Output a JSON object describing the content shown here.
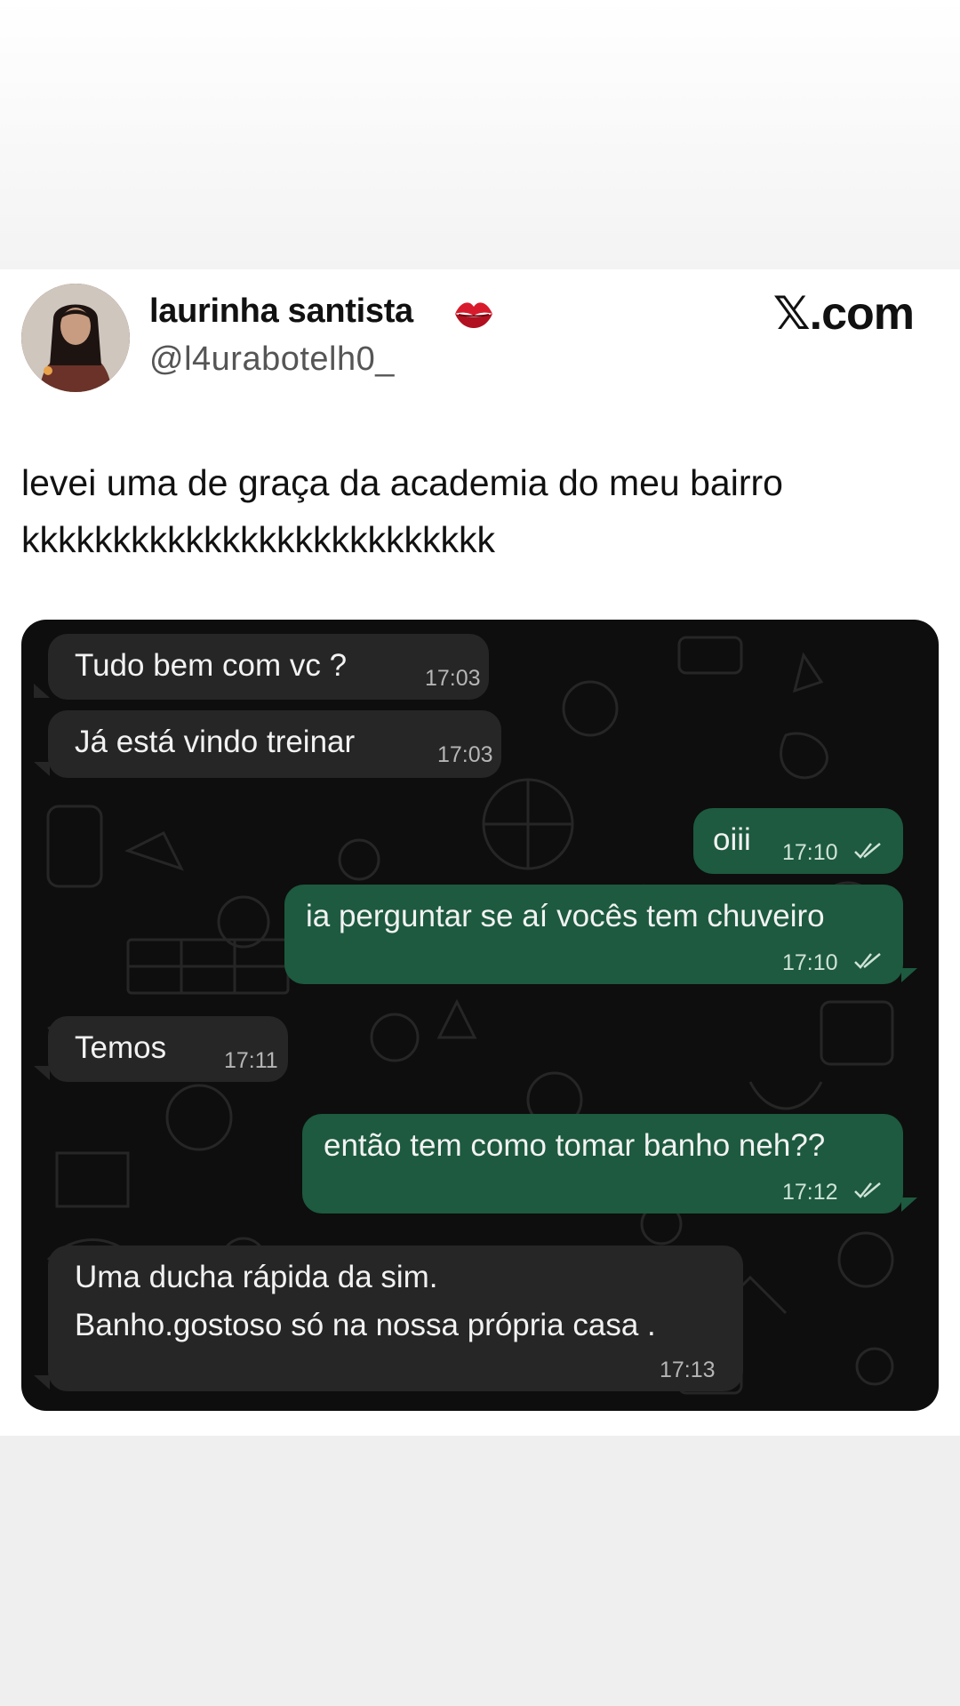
{
  "tweet": {
    "display_name": "laurinha santista",
    "name_emoji": "kiss-mark-icon",
    "handle": "@l4urabotelh0_",
    "brand": "𝕏.com",
    "text_lines": [
      "levei uma de graça da academia do meu bairro",
      "kkkkkkkkkkkkkkkkkkkkkkkkkk"
    ]
  },
  "chat": {
    "theme": {
      "background": "#0e0e0e",
      "incoming": "#262626",
      "outgoing": "#1d5a3f"
    },
    "messages": [
      {
        "direction": "in",
        "lines": [
          "Tudo bem com vc ?"
        ],
        "time": "17:03"
      },
      {
        "direction": "in",
        "lines": [
          "Já está vindo treinar"
        ],
        "time": "17:03"
      },
      {
        "direction": "out",
        "lines": [
          "oiii"
        ],
        "time": "17:10",
        "status": "read-ticks-icon"
      },
      {
        "direction": "out",
        "lines": [
          "ia perguntar se aí vocês tem chuveiro"
        ],
        "time": "17:10",
        "status": "read-ticks-icon"
      },
      {
        "direction": "in",
        "lines": [
          "Temos"
        ],
        "time": "17:11"
      },
      {
        "direction": "out",
        "lines": [
          "então tem como tomar banho neh??"
        ],
        "time": "17:12",
        "status": "read-ticks-icon"
      },
      {
        "direction": "in",
        "lines": [
          "Uma ducha rápida da sim.",
          "Banho.gostoso só na nossa própria casa ."
        ],
        "time": "17:13"
      }
    ]
  }
}
